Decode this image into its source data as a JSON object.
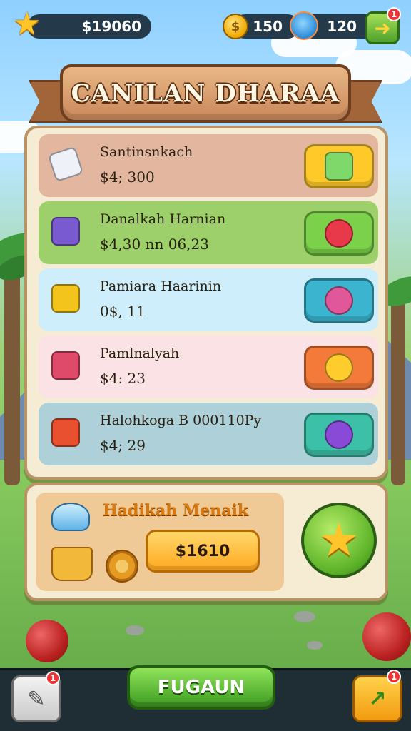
{
  "hud": {
    "score": "$19060",
    "coins": "150",
    "gems": "120",
    "notification_count": "1"
  },
  "banner": {
    "title": "CANILAN DHARAA"
  },
  "list": {
    "rows": [
      {
        "title": "Santinsnkach",
        "value": "$4; 300",
        "icon": "paper-glove-icon",
        "button_icon": "gift-box-icon",
        "color": "#e3b6a0",
        "button_color": "#ffc92a"
      },
      {
        "title": "Danalkah Harnian",
        "value": "$4,30  nn  06,23",
        "icon": "treasure-chest-icon",
        "button_icon": "candy-icon",
        "color": "#9dd06b",
        "button_color": "#7bd14a"
      },
      {
        "title": "Pamiara Haarinin",
        "value": "0$, 11",
        "icon": "toolbox-icon",
        "button_icon": "gem-icon",
        "color": "#cdeefa",
        "button_color": "#3ab4cf"
      },
      {
        "title": "Pamlnalyah",
        "value": "$4: 23",
        "icon": "radio-box-icon",
        "button_icon": "coin-icon",
        "color": "#fbe2e4",
        "button_color": "#f47a3a"
      },
      {
        "title": "Halohkoga B  000110Py",
        "value": "$4; 29",
        "icon": "machine-box-icon",
        "button_icon": "orb-icon",
        "color": "#aed0d9",
        "button_color": "#3cc0a8"
      }
    ]
  },
  "reward": {
    "title": "Hadikah Menaik",
    "button_label": "$1610",
    "icon_top": "ufo-icon",
    "icon_bottom": "fruit-basket-icon",
    "small_icon": "donut-coin-icon",
    "round_button_icon": "star-icon"
  },
  "bottom": {
    "main_label": "FUGAUN",
    "left_badge": "1",
    "right_badge": "1"
  }
}
